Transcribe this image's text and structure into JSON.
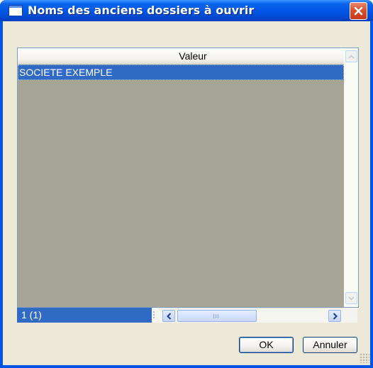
{
  "window": {
    "title": "Noms des anciens dossiers à ouvrir",
    "title_icon": "window-icon",
    "close_icon": "close-icon"
  },
  "grid": {
    "column_header": "Valeur",
    "rows": [
      "SOCIETE EXEMPLE"
    ],
    "selected_row": 0,
    "counter": "1 (1)"
  },
  "buttons": {
    "ok": "OK",
    "cancel": "Annuler"
  },
  "colors": {
    "selection": "#316ac5",
    "grid_background": "#a7a597",
    "dialog_background": "#ece9d8",
    "titlebar": "#0054e3",
    "close_button": "#d9512e"
  }
}
